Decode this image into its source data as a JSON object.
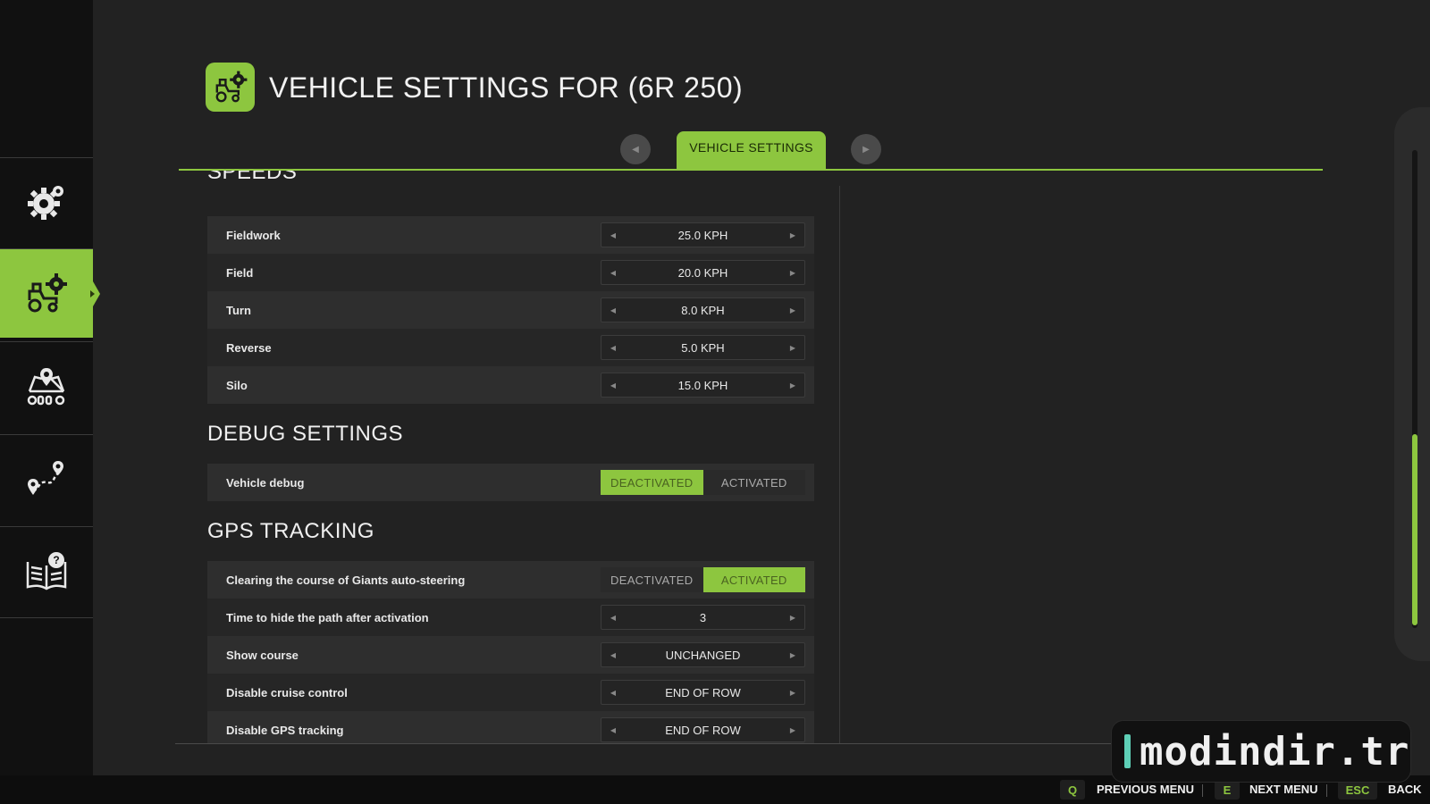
{
  "header": {
    "title": "VEHICLE SETTINGS FOR (6R 250)",
    "icon": "tractor-gear-icon"
  },
  "sidebar": {
    "items": [
      {
        "icon": "gear-icon",
        "active": false
      },
      {
        "icon": "tractor-gear-icon",
        "active": true
      },
      {
        "icon": "field-map-icon",
        "active": false
      },
      {
        "icon": "route-pins-icon",
        "active": false
      },
      {
        "icon": "help-book-icon",
        "active": false
      }
    ]
  },
  "tabs": {
    "active_label": "VEHICLE SETTINGS"
  },
  "sections": {
    "speeds": {
      "title": "SPEEDS",
      "rows": [
        {
          "label": "Fieldwork",
          "value": "25.0 KPH"
        },
        {
          "label": "Field",
          "value": "20.0 KPH"
        },
        {
          "label": "Turn",
          "value": "8.0 KPH"
        },
        {
          "label": "Reverse",
          "value": "5.0 KPH"
        },
        {
          "label": "Silo",
          "value": "15.0 KPH"
        }
      ]
    },
    "debug": {
      "title": "DEBUG SETTINGS",
      "rows": [
        {
          "label": "Vehicle debug",
          "off": "DEACTIVATED",
          "on": "ACTIVATED",
          "selected": "DEACTIVATED"
        }
      ]
    },
    "gps": {
      "title": "GPS TRACKING",
      "toggle": {
        "label": "Clearing the course of Giants auto-steering",
        "off": "DEACTIVATED",
        "on": "ACTIVATED",
        "selected": "ACTIVATED"
      },
      "rows": [
        {
          "label": "Time to hide the path after activation",
          "value": "3"
        },
        {
          "label": "Show course",
          "value": "UNCHANGED"
        },
        {
          "label": "Disable cruise control",
          "value": "END OF ROW"
        },
        {
          "label": "Disable GPS tracking",
          "value": "END OF ROW"
        }
      ]
    }
  },
  "footer": {
    "prev": {
      "key": "Q",
      "label": "PREVIOUS MENU"
    },
    "next": {
      "key": "E",
      "label": "NEXT MENU"
    },
    "back": {
      "key": "ESC",
      "label": "BACK"
    }
  },
  "watermark": {
    "text": "modindir.tr"
  },
  "colors": {
    "accent": "#8dc63f",
    "background": "#222222",
    "sidebar": "#111111"
  }
}
